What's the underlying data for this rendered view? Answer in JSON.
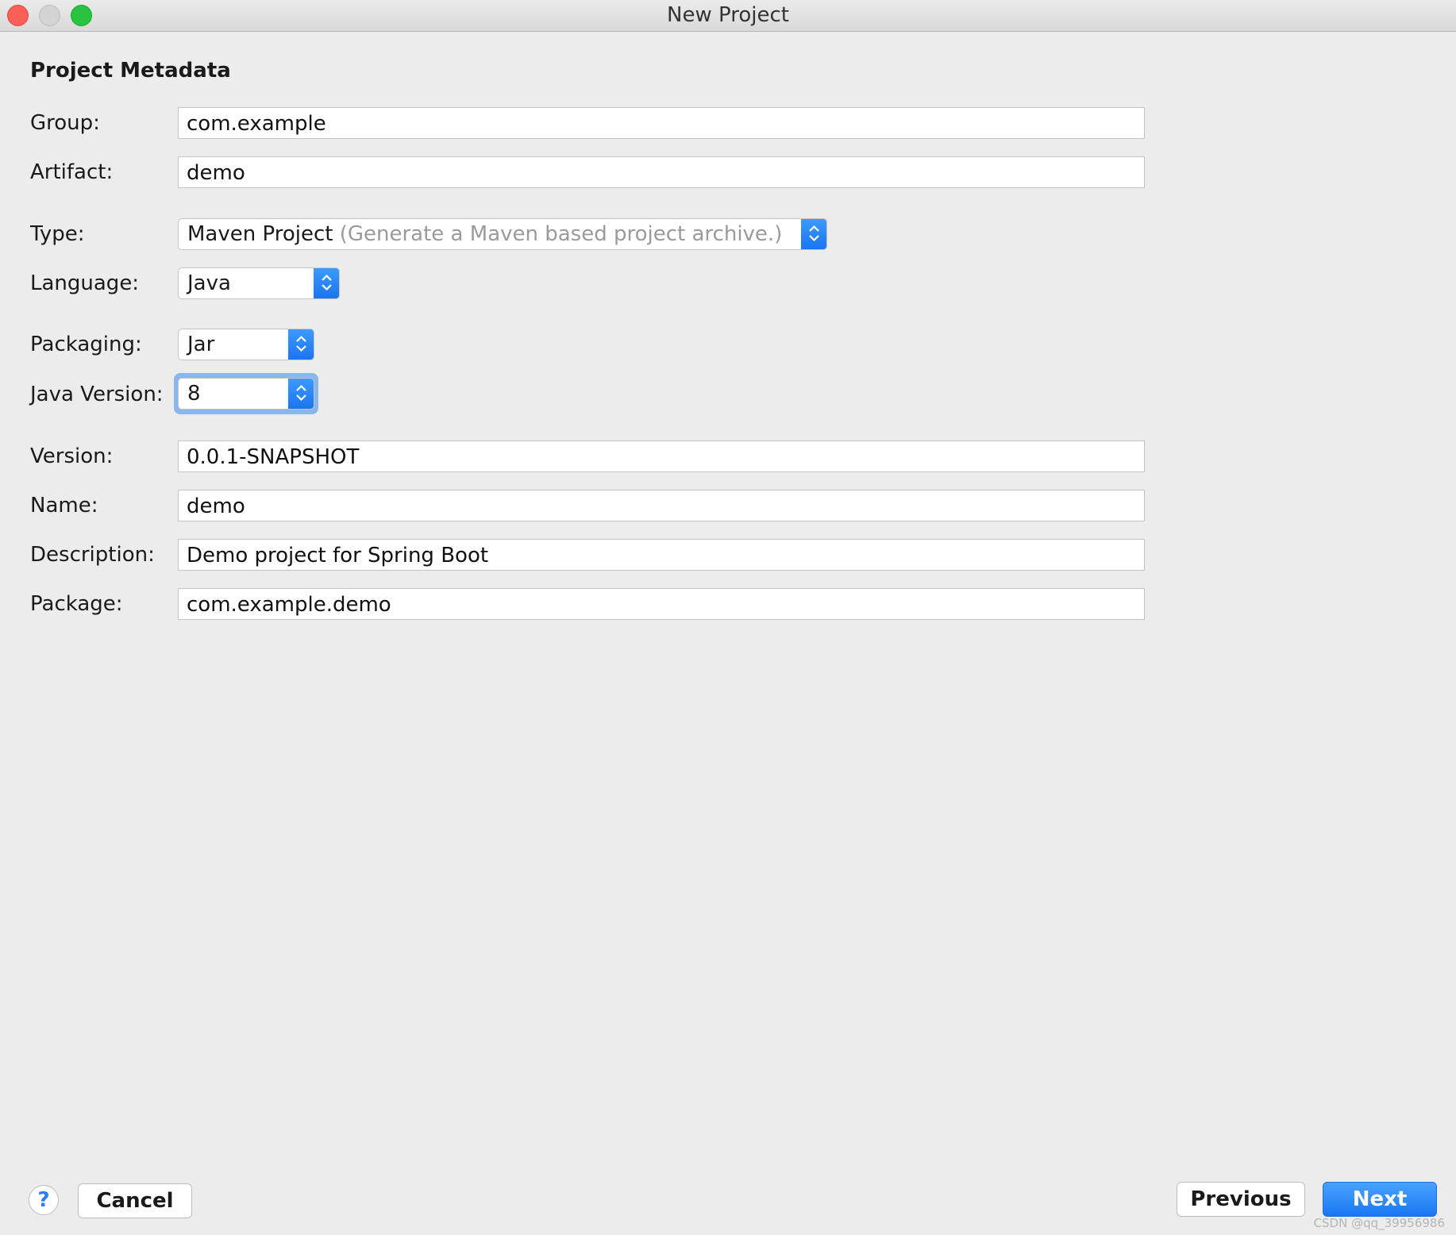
{
  "window": {
    "title": "New Project"
  },
  "section_title": "Project Metadata",
  "fields": {
    "group": {
      "label": "Group:",
      "value": "com.example"
    },
    "artifact": {
      "label": "Artifact:",
      "value": "demo"
    },
    "version": {
      "label": "Version:",
      "value": "0.0.1-SNAPSHOT"
    },
    "name": {
      "label": "Name:",
      "value": "demo"
    },
    "description": {
      "label": "Description:",
      "value": "Demo project for Spring Boot"
    },
    "package": {
      "label": "Package:",
      "value": "com.example.demo"
    }
  },
  "selects": {
    "type": {
      "label": "Type:",
      "value": "Maven Project",
      "hint": "(Generate a Maven based project archive.)"
    },
    "language": {
      "label": "Language:",
      "value": "Java"
    },
    "packaging": {
      "label": "Packaging:",
      "value": "Jar"
    },
    "java_version": {
      "label": "Java Version:",
      "value": "8",
      "focused": true
    }
  },
  "buttons": {
    "help": "?",
    "cancel": "Cancel",
    "previous": "Previous",
    "next": "Next"
  },
  "icons": {
    "stepper": "chevron-up-down-icon",
    "help": "question-mark-icon"
  },
  "colors": {
    "accent": "#1a77f2",
    "close": "#fc5f57",
    "minimize": "#d3d3d3",
    "maximize": "#2ac33f",
    "background": "#ececec"
  },
  "watermark": "CSDN @qq_39956986"
}
